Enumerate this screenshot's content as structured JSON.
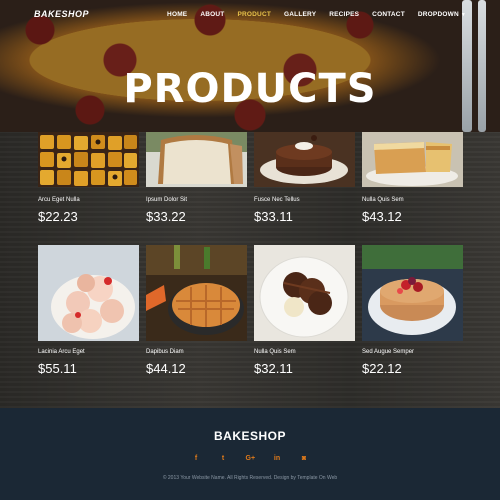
{
  "nav": {
    "brand": "BAKESHOP",
    "items": [
      {
        "label": "HOME"
      },
      {
        "label": "ABOUT"
      },
      {
        "label": "PRODUCT"
      },
      {
        "label": "GALLERY"
      },
      {
        "label": "RECIPES"
      },
      {
        "label": "CONTACT"
      },
      {
        "label": "DROPDOWN"
      }
    ]
  },
  "hero": {
    "title": "PRODUCTS"
  },
  "products": [
    {
      "name": "Arcu Eget Nulla",
      "price": "$22.23"
    },
    {
      "name": "Ipsum Dolor Sit",
      "price": "$33.22"
    },
    {
      "name": "Fusce Nec Tellus",
      "price": "$33.11"
    },
    {
      "name": "Nulla Quis Sem",
      "price": "$43.12"
    },
    {
      "name": "Lacinia Arcu Eget",
      "price": "$55.11"
    },
    {
      "name": "Dapibus Diam",
      "price": "$44.12"
    },
    {
      "name": "Nulla Quis Sem",
      "price": "$32.11"
    },
    {
      "name": "Sed Augue Semper",
      "price": "$22.12"
    }
  ],
  "footer": {
    "brand": "BAKESHOP",
    "social": [
      "f",
      "t",
      "G+",
      "in",
      "camera"
    ],
    "copyright": "© 2013 Your Website Name. All Rights Reserved. Design by Template On Web"
  },
  "colors": {
    "active": "#e8c24a",
    "social": "#e07a1a",
    "footer_bg": "#1b2835"
  }
}
